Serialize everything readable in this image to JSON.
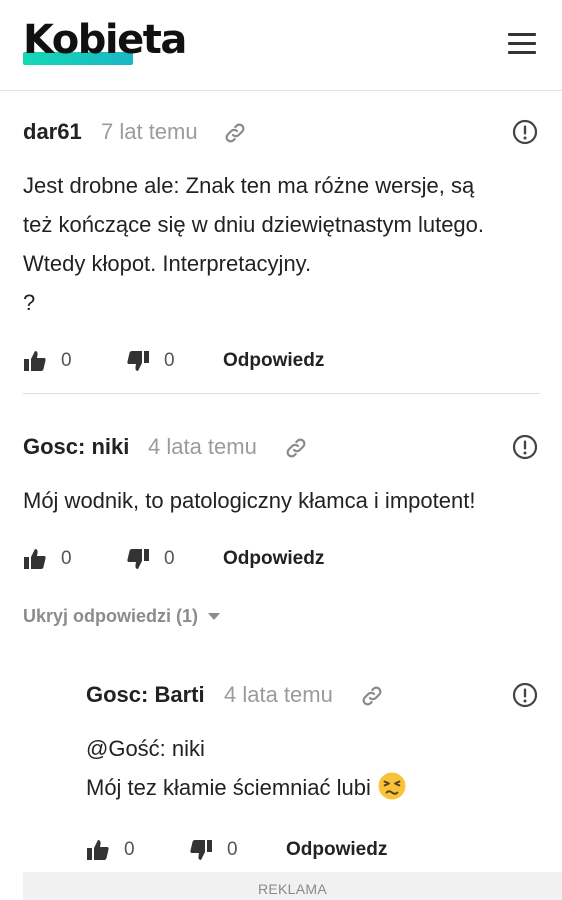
{
  "header": {
    "logo_text": "Kobieta",
    "menu_icon": "hamburger-menu-icon",
    "logo_accent": "#14d9b4"
  },
  "comments": [
    {
      "author": "dar61",
      "time": "7 lat temu",
      "body": [
        "Jest drobne ale: Znak ten ma różne wersje, są",
        "też kończące się w dniu dziewiętnastym lutego.",
        "Wtedy kłopot. Interpretacyjny.",
        "?"
      ],
      "likes": "0",
      "dislikes": "0",
      "reply_label": "Odpowiedz"
    },
    {
      "author": "Gosc: niki",
      "time": "4 lata temu",
      "body": [
        "Mój wodnik, to patologiczny kłamca i impotent!"
      ],
      "likes": "0",
      "dislikes": "0",
      "reply_label": "Odpowiedz"
    }
  ],
  "replies_toggle": "Ukryj odpowiedzi (1)",
  "reply": {
    "author": "Gosc: Barti",
    "time": "4 lata temu",
    "body_line1": "@Gość: niki",
    "body_line2": "Mój tez kłamie ściemniać lubi",
    "emoji_icon": "persevering-face-emoji-icon",
    "likes": "0",
    "dislikes": "0",
    "reply_label": "Odpowiedz"
  },
  "ad_label": "REKLAMA"
}
